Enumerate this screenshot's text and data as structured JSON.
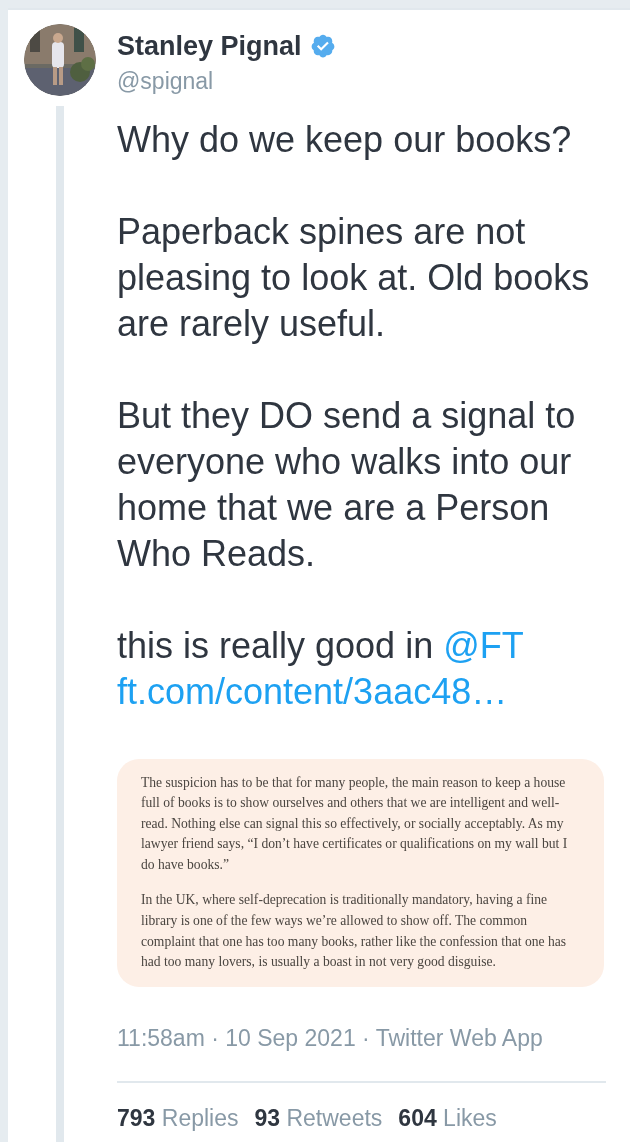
{
  "author": {
    "name": "Stanley Pignal",
    "handle": "@spignal",
    "verified": true
  },
  "paragraphs": [
    [
      {
        "kind": "text",
        "text": "Why do we keep our books?"
      }
    ],
    [
      {
        "kind": "text",
        "text": "Paperback spines are not pleasing to look at. Old books are rarely useful."
      }
    ],
    [
      {
        "kind": "text",
        "text": "But they DO send a signal to everyone who walks into our home that we are a Person Who Reads."
      }
    ],
    [
      {
        "kind": "text",
        "text": "this is really good in "
      },
      {
        "kind": "mention",
        "text": "@FT"
      },
      {
        "kind": "url",
        "text": "ft.com/content/3aac48…"
      }
    ]
  ],
  "quote_image": {
    "paragraphs": [
      "The suspicion has to be that for many people, the main reason to keep a house full of books is to show ourselves and others that we are intelligent and well-read. Nothing else can signal this so effectively, or socially acceptably. As my lawyer friend says, “I don’t have certificates or qualifications on my wall but I do have books.”",
      "In the UK, where self-deprecation is traditionally mandatory, having a fine library is one of the few ways we’re allowed to show off. The common complaint that one has too many books, rather like the confession that one has had too many lovers, is usually a boast in not very good disguise."
    ]
  },
  "timestamp": "11:58am · 10 Sep 2021 · Twitter Web App",
  "stats": [
    {
      "count": "793",
      "label": "Replies"
    },
    {
      "count": "93",
      "label": "Retweets"
    },
    {
      "count": "604",
      "label": "Likes"
    }
  ]
}
